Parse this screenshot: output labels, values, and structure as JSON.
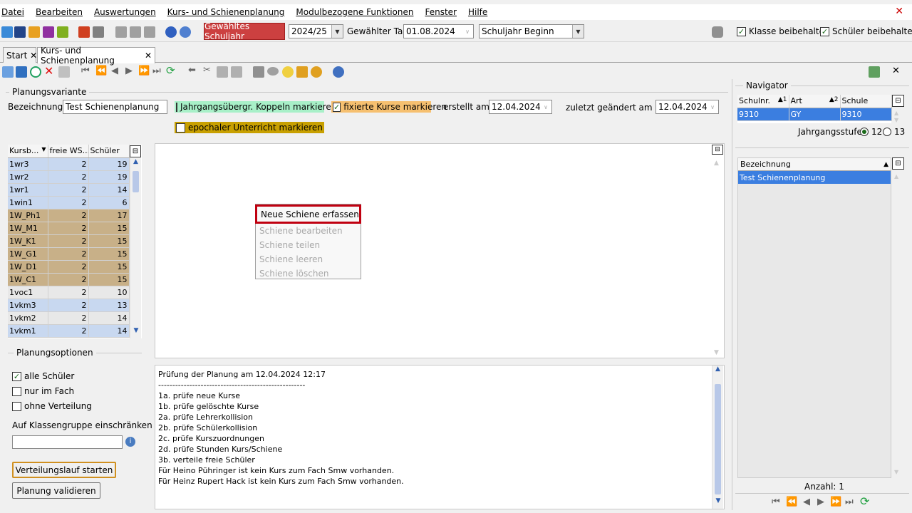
{
  "menu": {
    "items": [
      "Datei",
      "Bearbeiten",
      "Auswertungen",
      "Kurs- und Schienenplanung",
      "Modulbezogene Funktionen",
      "Fenster",
      "Hilfe"
    ]
  },
  "toolbar": {
    "schuljahr_button": "Gewähltes Schuljahr",
    "schuljahr_value": "2024/25",
    "tag_label": "Gewählter Tag",
    "tag_value": "01.08.2024",
    "period_value": "Schuljahr Beginn",
    "klasse_label": "Klasse beibehalten",
    "schueler_label": "Schüler beibehalten"
  },
  "tabs": {
    "start": "Start",
    "kurs": "Kurs- und Schienenplanung"
  },
  "planungsvariante": {
    "section": "Planungsvariante",
    "bezeichnung_label": "Bezeichnung",
    "bezeichnung_value": "Test Schienenplanung",
    "jahrgang_label": "Jahrgangsübergr. Koppeln markieren",
    "fixiert_label": "fixierte Kurse markieren",
    "epochal_label": "epochaler Unterricht markieren",
    "erstellt_label": "erstellt am",
    "erstellt_value": "12.04.2024",
    "geaendert_label": "zuletzt geändert am",
    "geaendert_value": "12.04.2024",
    "colors": {
      "jahrgang": "#a8f0c8",
      "fixiert": "#f6c070",
      "epochal": "#c8a000"
    }
  },
  "courses": {
    "headers": [
      "Kursb...",
      "freie WS...",
      "Schüler"
    ],
    "rows": [
      {
        "name": "1wr3",
        "ws": "2",
        "s": "19",
        "type": "blue"
      },
      {
        "name": "1wr2",
        "ws": "2",
        "s": "19",
        "type": "blue"
      },
      {
        "name": "1wr1",
        "ws": "2",
        "s": "14",
        "type": "blue"
      },
      {
        "name": "1win1",
        "ws": "2",
        "s": "6",
        "type": "blue"
      },
      {
        "name": "1W_Ph1",
        "ws": "2",
        "s": "17",
        "type": "tan"
      },
      {
        "name": "1W_M1",
        "ws": "2",
        "s": "15",
        "type": "tan"
      },
      {
        "name": "1W_K1",
        "ws": "2",
        "s": "15",
        "type": "tan"
      },
      {
        "name": "1W_G1",
        "ws": "2",
        "s": "15",
        "type": "tan"
      },
      {
        "name": "1W_D1",
        "ws": "2",
        "s": "15",
        "type": "tan"
      },
      {
        "name": "1W_C1",
        "ws": "2",
        "s": "15",
        "type": "tan"
      },
      {
        "name": "1voc1",
        "ws": "2",
        "s": "10",
        "type": "gray"
      },
      {
        "name": "1vkm3",
        "ws": "2",
        "s": "13",
        "type": "blue"
      },
      {
        "name": "1vkm2",
        "ws": "2",
        "s": "14",
        "type": "gray"
      },
      {
        "name": "1vkm1",
        "ws": "2",
        "s": "14",
        "type": "blue"
      }
    ]
  },
  "context_menu": {
    "items": [
      "Neue Schiene erfassen",
      "Schiene bearbeiten",
      "Schiene teilen",
      "Schiene leeren",
      "Schiene löschen"
    ]
  },
  "planungsoptionen": {
    "section": "Planungsoptionen",
    "alle": "alle Schüler",
    "nur": "nur im Fach",
    "ohne": "ohne Verteilung",
    "klassen_label": "Auf Klassengruppe einschränken",
    "btn_verteilung": "Verteilungslauf starten",
    "btn_validieren": "Planung validieren"
  },
  "log": {
    "lines": [
      "Prüfung der Planung am 12.04.2024 12:17",
      "----------------------------------------------------",
      "1a. prüfe neue Kurse",
      "1b. prüfe gelöschte Kurse",
      "2a. prüfe Lehrerkollision",
      "2b. prüfe Schülerkollision",
      "2c. prüfe Kurszuordnungen",
      "2d. prüfe Stunden Kurs/Schiene",
      "3b. verteile freie Schüler",
      "Für Heino Pühringer ist kein Kurs zum Fach Smw vorhanden.",
      "Für Heinz Rupert Hack ist kein Kurs zum Fach Smw vorhanden."
    ]
  },
  "navigator": {
    "title": "Navigator",
    "headers": [
      "Schulnr.",
      "Art",
      "Schule"
    ],
    "sort": [
      "1",
      "2"
    ],
    "row": [
      "9310",
      "GY",
      "9310"
    ],
    "jahrgang_label": "Jahrgangsstufe",
    "opt12": "12",
    "opt13": "13",
    "bez_header": "Bezeichnung",
    "bez_row": "Test Schienenplanung",
    "anzahl": "Anzahl: 1"
  }
}
